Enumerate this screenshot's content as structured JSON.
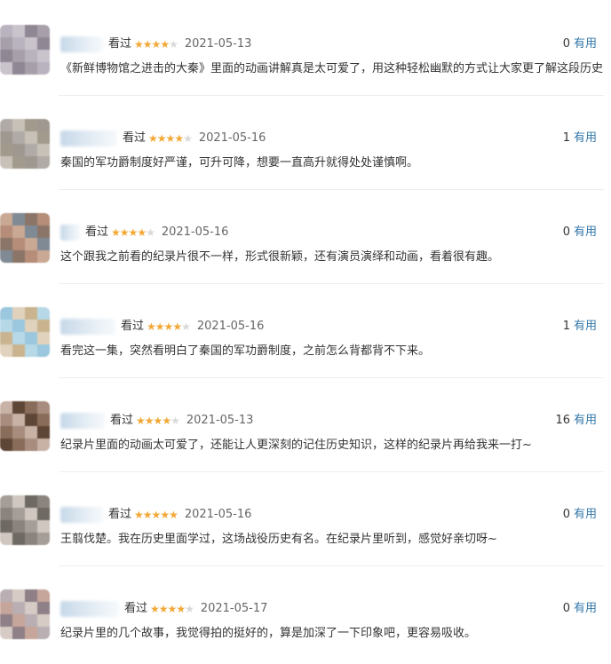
{
  "reviews": [
    {
      "watched": "看过",
      "rating": 4,
      "date": "2021-05-13",
      "votes": "0",
      "useful": "有用",
      "comment": "《新鲜博物馆之进击的大秦》里面的动画讲解真是太可爱了，用这种轻松幽默的方式让大家更了解这段历史"
    },
    {
      "watched": "看过",
      "rating": 4,
      "date": "2021-05-16",
      "votes": "1",
      "useful": "有用",
      "comment": "秦国的军功爵制度好严谨，可升可降，想要一直高升就得处处谨慎啊。"
    },
    {
      "watched": "看过",
      "rating": 4,
      "date": "2021-05-16",
      "votes": "0",
      "useful": "有用",
      "comment": "这个跟我之前看的纪录片很不一样，形式很新颖，还有演员演绎和动画，看着很有趣。"
    },
    {
      "watched": "看过",
      "rating": 4,
      "date": "2021-05-16",
      "votes": "1",
      "useful": "有用",
      "comment": "看完这一集，突然看明白了秦国的军功爵制度，之前怎么背都背不下来。"
    },
    {
      "watched": "看过",
      "rating": 4,
      "date": "2021-05-13",
      "votes": "16",
      "useful": "有用",
      "comment": "纪录片里面的动画太可爱了，还能让人更深刻的记住历史知识，这样的纪录片再给我来一打~"
    },
    {
      "watched": "看过",
      "rating": 5,
      "date": "2021-05-16",
      "votes": "0",
      "useful": "有用",
      "comment": "王翦伐楚。我在历史里面学过，这场战役历史有名。在纪录片里听到，感觉好亲切呀~"
    },
    {
      "watched": "看过",
      "rating": 4,
      "date": "2021-05-17",
      "votes": "0",
      "useful": "有用",
      "comment": "纪录片里的几个故事，我觉得拍的挺好的，算是加深了一下印象吧，更容易吸收。"
    }
  ],
  "colors": {
    "star_on": "#f3a836",
    "star_off": "#d9d9d9",
    "link": "#3377aa"
  }
}
